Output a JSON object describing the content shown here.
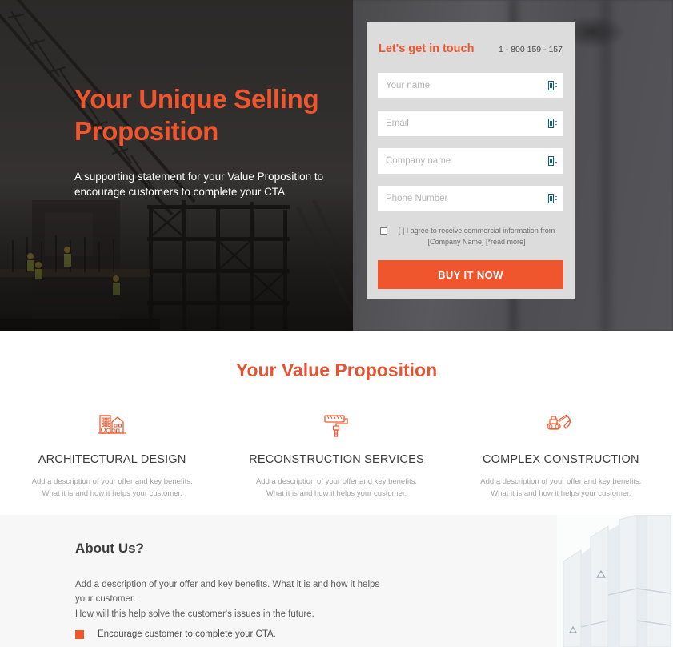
{
  "hero": {
    "title": "Your Unique Selling Proposition",
    "subtitle": "A supporting statement for your Value Proposition to encourage customers to complete your CTA",
    "background_image": "construction-site-crane-photo"
  },
  "form": {
    "title": "Let's get in touch",
    "phone": "1 - 800 159 - 157",
    "fields": [
      {
        "name": "name",
        "placeholder": "Your name",
        "value": "",
        "icon": "broken-image-icon"
      },
      {
        "name": "email",
        "placeholder": "Email",
        "value": "",
        "icon": "broken-image-icon"
      },
      {
        "name": "company",
        "placeholder": "Company name",
        "value": "",
        "icon": "broken-image-icon"
      },
      {
        "name": "phone",
        "placeholder": "Phone Number",
        "value": "",
        "icon": "broken-image-icon"
      }
    ],
    "consent": {
      "checked": false,
      "line1": "[ ] I agree to receive commercial information from",
      "line2": "[Company Name] [*read more]"
    },
    "cta_label": "BUY IT NOW"
  },
  "value_section": {
    "title": "Your Value Proposition",
    "features": [
      {
        "icon": "buildings-icon",
        "name": "ARCHITECTURAL DESIGN",
        "desc_line1": "Add a description of your offer and key benefits.",
        "desc_line2": "What it is and how it helps your customer."
      },
      {
        "icon": "paint-roller-icon",
        "name": "RECONSTRUCTION SERVICES",
        "desc_line1": "Add a description of your offer and key benefits.",
        "desc_line2": "What it is and how it helps your customer."
      },
      {
        "icon": "excavator-icon",
        "name": "COMPLEX CONSTRUCTION",
        "desc_line1": "Add a description of your offer and key benefits.",
        "desc_line2": "What it is and how it helps your customer."
      }
    ]
  },
  "about_section": {
    "title": "About Us?",
    "paragraph": "Add a description of your offer and key benefits. What it is and how it helps your customer.",
    "line2": "How will this help solve the customer's issues in the future.",
    "bullet": "Encourage customer to complete your CTA.",
    "side_image": "white-glass-architecture-photo"
  },
  "colors": {
    "accent": "#f0562e",
    "value_title": "#e35433",
    "form_bg": "#dcdcdc",
    "about_bg": "#f7f7f8"
  }
}
